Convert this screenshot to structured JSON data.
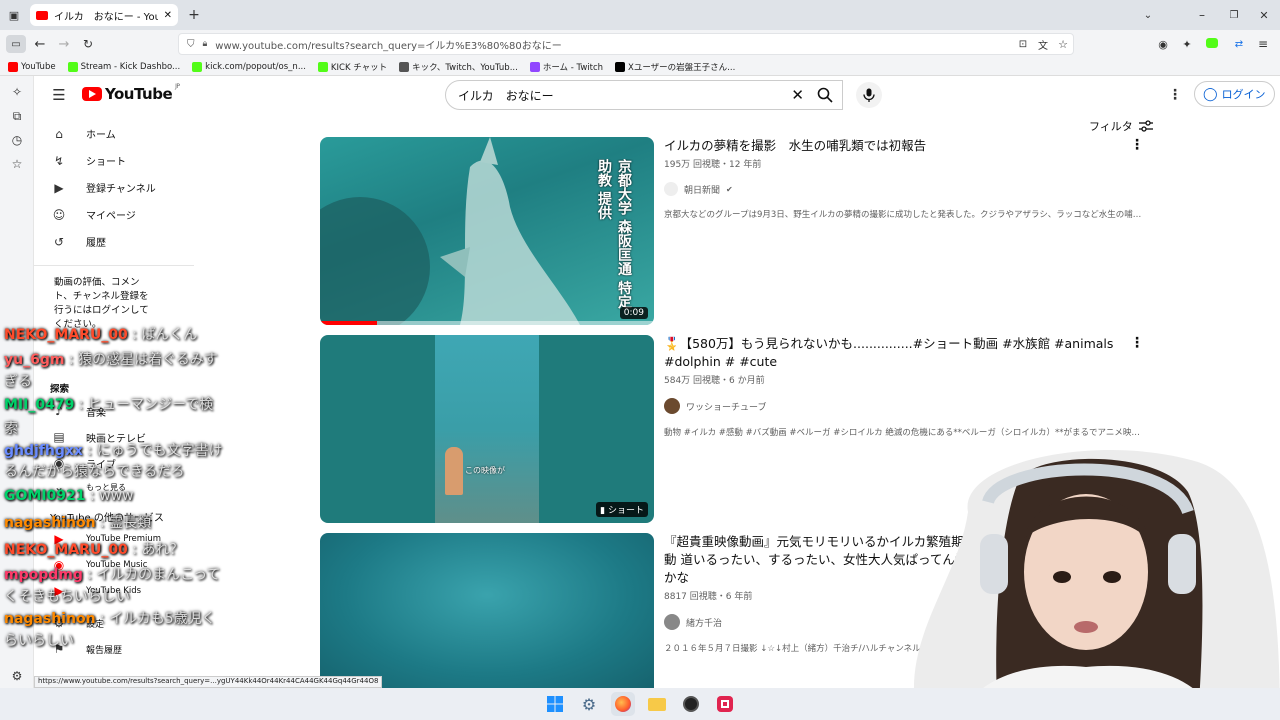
{
  "browser": {
    "tab_title": "イルカ　おなにー - YouTube",
    "url": "www.youtube.com/results?search_query=イルカ%E3%80%80おなにー",
    "bookmarks": [
      {
        "label": "YouTube",
        "color": "#ff0000"
      },
      {
        "label": "Stream - Kick Dashbo...",
        "color": "#53fc18"
      },
      {
        "label": "kick.com/popout/os_n...",
        "color": "#53fc18"
      },
      {
        "label": "KICK チャット",
        "color": "#53fc18"
      },
      {
        "label": "キック、Twitch、YouTub...",
        "color": "#555555"
      },
      {
        "label": "ホーム - Twitch",
        "color": "#9146ff"
      },
      {
        "label": "Xユーザーの岩盤王子さん...",
        "color": "#000000"
      }
    ],
    "status_url": "https://www.youtube.com/results?search_query=...ygUY44Kk44Or44Kr44CA44GK44Gq44Gr44O8"
  },
  "youtube": {
    "logo": "YouTube",
    "region": "JP",
    "search_value": "イルカ　おなにー",
    "signin": "ログイン",
    "filter": "フィルタ",
    "guide": {
      "items": [
        "ホーム",
        "ショート",
        "登録チャンネル",
        "マイページ",
        "履歴"
      ],
      "signin_prompt": "動画の評価、コメント、チャンネル登録を行うにはログインしてください。",
      "explore_title": "探索",
      "explore": [
        "音楽",
        "映画とテレビ",
        "ライブ",
        "もっと見る"
      ],
      "more_services_title": "YouTube の他のサービス",
      "services": [
        "YouTube Premium",
        "YouTube Music",
        "YouTube Kids"
      ],
      "settings": "設定",
      "report": "報告履歴"
    },
    "videos": [
      {
        "title": "イルカの夢精を撮影　水生の哺乳類では初報告",
        "meta": "195万 回視聴・12 年前",
        "channel": "朝日新聞",
        "desc": "京都大などのグループは9月3日、野生イルカの夢精の撮影に成功したと発表した。クジラやアザラシ、ラッコなど水生の哺乳類 ...",
        "duration": "0:09",
        "overlay_text": "京都大学 森阪匡通 特定助教 提供",
        "progress": 0.17
      },
      {
        "title": "🎖️【580万】もう見られないかも...............#ショート動画 #水族館 #animals #dolphin # #cute",
        "meta": "584万 回視聴・6 か月前",
        "channel": "ワッショーチューブ",
        "desc": "動物 #イルカ #感動 #バズ動画 #ベルーガ #シロイルカ 絶滅の危機にある**ベルーガ（シロイルカ）**がまるでアニメ映画から出 ...",
        "badge": "ショート",
        "caption": "この映像が"
      },
      {
        "title": "『超貴重映像動画』元気モリモリいるかイルカ繁殖期後の行動 道いるったい、するったい、女性大人気ぱってん博多弁かな",
        "meta": "8817 回視聴・6 年前",
        "channel": "緒方千治",
        "desc": "２０１６年５月７日撮影 ↓☆↓村上（緒方）千治チ/ハルチャンネル↓☆↓ https://www.youtube..."
      }
    ]
  },
  "chat": [
    {
      "user": "NEKO_MARU_00",
      "msg": "ばんくん",
      "color": "#ff4b2b"
    },
    {
      "user": "yu_6gm",
      "msg": "猿の惑星は着ぐるみすぎる",
      "color": "#ff5e5e"
    },
    {
      "user": "MII_0479",
      "msg": "ヒューマンジーで検索",
      "color": "#00d26a"
    },
    {
      "user": "ghdjfhgxx",
      "msg": "にゅうでも文字書けるんだから猿ならできるだろ",
      "color": "#6a8cff"
    },
    {
      "user": "GOMI0921",
      "msg": "www",
      "color": "#00d26a"
    },
    {
      "user": "nagashinon",
      "msg": "霊長類",
      "color": "#ff8a00"
    },
    {
      "user": "NEKO_MARU_00",
      "msg": "あれ？",
      "color": "#ff4b2b"
    },
    {
      "user": "mpopdmg",
      "msg": "イルカのまんこってくそきもちいらしい",
      "color": "#ff3a6a"
    },
    {
      "user": "nagashinon",
      "msg": "イルカも5歳児くらいらしい",
      "color": "#ff8a00"
    }
  ]
}
